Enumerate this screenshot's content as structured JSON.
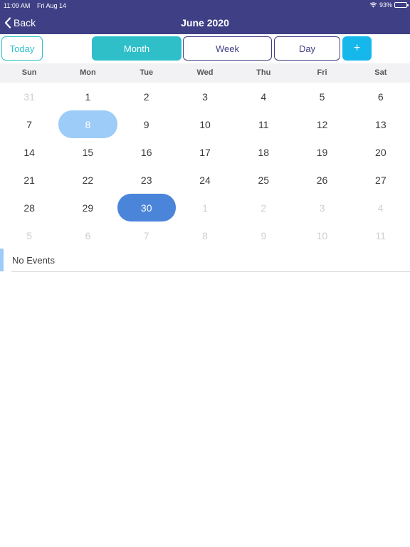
{
  "status_bar": {
    "time": "11:09 AM",
    "date": "Fri Aug 14",
    "battery": "93%",
    "battery_level": 0.93
  },
  "nav": {
    "back_label": "Back",
    "title": "June 2020"
  },
  "toolbar": {
    "today": "Today",
    "month": "Month",
    "week": "Week",
    "day": "Day",
    "add": "+"
  },
  "weekdays": [
    "Sun",
    "Mon",
    "Tue",
    "Wed",
    "Thu",
    "Fri",
    "Sat"
  ],
  "weeks": [
    [
      {
        "d": "31",
        "o": true
      },
      {
        "d": "1"
      },
      {
        "d": "2"
      },
      {
        "d": "3"
      },
      {
        "d": "4"
      },
      {
        "d": "5"
      },
      {
        "d": "6"
      }
    ],
    [
      {
        "d": "7"
      },
      {
        "d": "8",
        "s": "light"
      },
      {
        "d": "9"
      },
      {
        "d": "10"
      },
      {
        "d": "11"
      },
      {
        "d": "12"
      },
      {
        "d": "13"
      }
    ],
    [
      {
        "d": "14"
      },
      {
        "d": "15"
      },
      {
        "d": "16"
      },
      {
        "d": "17"
      },
      {
        "d": "18"
      },
      {
        "d": "19"
      },
      {
        "d": "20"
      }
    ],
    [
      {
        "d": "21"
      },
      {
        "d": "22"
      },
      {
        "d": "23"
      },
      {
        "d": "24"
      },
      {
        "d": "25"
      },
      {
        "d": "26"
      },
      {
        "d": "27"
      }
    ],
    [
      {
        "d": "28"
      },
      {
        "d": "29"
      },
      {
        "d": "30",
        "s": "dark"
      },
      {
        "d": "1",
        "o": true
      },
      {
        "d": "2",
        "o": true
      },
      {
        "d": "3",
        "o": true
      },
      {
        "d": "4",
        "o": true
      }
    ],
    [
      {
        "d": "5",
        "o": true
      },
      {
        "d": "6",
        "o": true
      },
      {
        "d": "7",
        "o": true
      },
      {
        "d": "8",
        "o": true
      },
      {
        "d": "9",
        "o": true
      },
      {
        "d": "10",
        "o": true
      },
      {
        "d": "11",
        "o": true
      }
    ]
  ],
  "events": {
    "empty_label": "No Events"
  },
  "colors": {
    "header": "#3f3f85",
    "accent_teal": "#2fbfc9",
    "add_blue": "#16b8ec",
    "selected_dark": "#4a85da",
    "selected_light": "#9cccf7"
  },
  "icons": {
    "back": "chevron-left-icon",
    "wifi": "wifi-icon",
    "battery": "battery-icon"
  }
}
